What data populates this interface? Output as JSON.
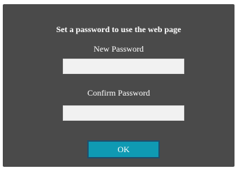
{
  "dialog": {
    "title": "Set a password to use the web page",
    "new_password": {
      "label": "New Password",
      "value": "",
      "placeholder": ""
    },
    "confirm_password": {
      "label": "Confirm Password",
      "value": "",
      "placeholder": ""
    },
    "ok_label": "OK"
  },
  "colors": {
    "dialog_background": "#4a4a4a",
    "field_background": "#f1f1f1",
    "button_background": "#0f9ab3",
    "button_border": "#1f4e6c",
    "text": "#ffffff"
  }
}
